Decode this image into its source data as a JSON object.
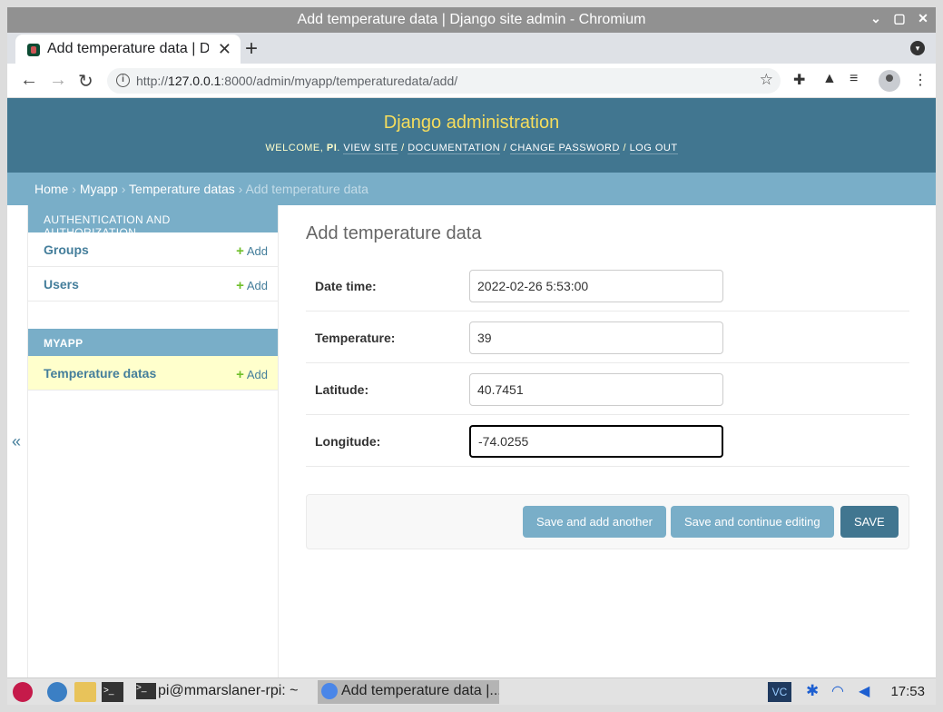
{
  "window": {
    "title": "Add temperature data | Django site admin - Chromium",
    "controls": [
      "⌄",
      "▢",
      "✕"
    ]
  },
  "tab": {
    "title": "Add temperature data | Django site admin",
    "close": "✕",
    "new_tab": "+"
  },
  "toolbar": {
    "back": "←",
    "forward": "→",
    "reload": "↻",
    "url_host": "127.0.0.1",
    "url_prefix": "http://",
    "url_rest": ":8000/admin/myapp/temperaturedata/add/",
    "star": "☆"
  },
  "header": {
    "brand": "Django administration",
    "welcome": "WELCOME, ",
    "user": "PI",
    "links": [
      "VIEW SITE",
      "DOCUMENTATION",
      "CHANGE PASSWORD",
      "LOG OUT"
    ]
  },
  "breadcrumbs": [
    "Home",
    "Myapp",
    "Temperature datas",
    "Add temperature data"
  ],
  "sidebar": {
    "toggle": "«",
    "modules": [
      {
        "caption": "AUTHENTICATION AND AUTHORIZATION",
        "models": [
          {
            "name": "Groups",
            "add": "Add"
          },
          {
            "name": "Users",
            "add": "Add"
          }
        ]
      },
      {
        "caption": "MYAPP",
        "models": [
          {
            "name": "Temperature datas",
            "add": "Add"
          }
        ]
      }
    ]
  },
  "content": {
    "title": "Add temperature data",
    "fields": [
      {
        "label": "Date time:",
        "value": "2022-02-26 5:53:00"
      },
      {
        "label": "Temperature:",
        "value": "39"
      },
      {
        "label": "Latitude:",
        "value": "40.7451"
      },
      {
        "label": "Longitude:",
        "value": "-74.0255"
      }
    ],
    "buttons": {
      "save_add": "Save and add another",
      "save_continue": "Save and continue editing",
      "save": "SAVE"
    }
  },
  "taskbar": {
    "terminal_item": "pi@mmarslaner-rpi: ~",
    "browser_item": "Add temperature data |...",
    "clock": "17:53"
  },
  "colors": {
    "header": "#417690",
    "breadcrumbs": "#79aec8",
    "brand": "#f5dd5d",
    "add_plus": "#70bf2b",
    "current_row": "#ffffcc"
  }
}
